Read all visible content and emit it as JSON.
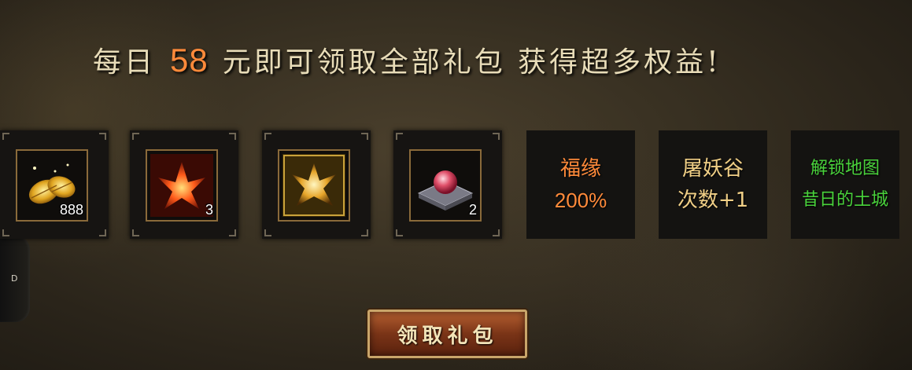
{
  "headline": {
    "prefix": "每日",
    "amount": "58",
    "suffix": "元即可领取全部礼包 获得超多权益!"
  },
  "rewards": [
    {
      "icon": "gold-leaf-icon",
      "qty": "888"
    },
    {
      "icon": "red-crystal-icon",
      "qty": "3"
    },
    {
      "icon": "gold-crystal-icon",
      "qty": ""
    },
    {
      "icon": "pink-pearl-icon",
      "qty": "2"
    }
  ],
  "text_rewards": [
    {
      "line1": "福缘",
      "line2": "200%",
      "color": "#ff8a3a"
    },
    {
      "line1": "屠妖谷",
      "line2": "次数+1",
      "color": "#f0cf86"
    },
    {
      "line1": "解锁地图",
      "line2": "昔日的土城",
      "color": "#49d23b"
    }
  ],
  "claim_button": {
    "label": "领取礼包"
  },
  "side_handle": {
    "label": "D"
  }
}
